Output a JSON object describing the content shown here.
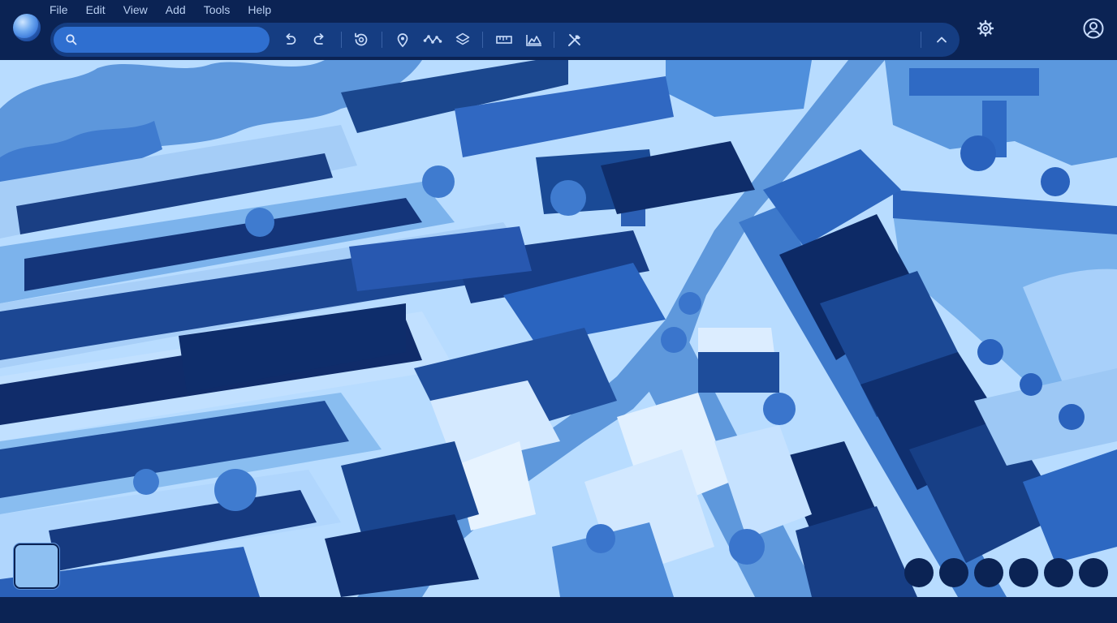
{
  "menu": [
    "File",
    "Edit",
    "View",
    "Add",
    "Tools",
    "Help"
  ],
  "search": {
    "placeholder": "",
    "value": ""
  },
  "toolbar": {
    "icons": [
      "undo-icon",
      "redo-icon",
      "history-icon",
      "placemark-icon",
      "path-icon",
      "layers-icon",
      "ruler-icon",
      "elevation-icon",
      "tools-icon",
      "collapse-icon"
    ]
  },
  "colors": {
    "chrome": "#0b2354",
    "toolbar": "#153d82",
    "search": "#2f6fd0",
    "icon": "#c8dbfa",
    "map_light": "#b8dcff",
    "map_mid": "#4f8fdc",
    "map_dark": "#0e2d6b"
  },
  "map": {
    "view": "3d-aerial-town"
  },
  "bottom_controls": {
    "count": 6
  }
}
